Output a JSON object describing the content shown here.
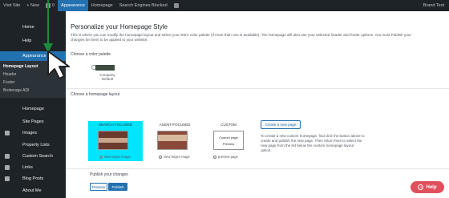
{
  "topbar": {
    "items": [
      {
        "label": "Visit Site"
      },
      {
        "label": "+ New"
      },
      {
        "label": "0"
      },
      {
        "label": "Appearance"
      },
      {
        "label": "Homepage"
      },
      {
        "label": "Search Engines Blocked"
      }
    ],
    "right_label": "Brand Test"
  },
  "sidebar": {
    "items": [
      {
        "label": "Home"
      },
      {
        "label": "Help"
      },
      {
        "label": "Appearance"
      },
      {
        "label": "Homepage"
      },
      {
        "label": "Site Pages"
      },
      {
        "label": "Images"
      },
      {
        "label": "Property Lists"
      },
      {
        "label": "Custom Search"
      },
      {
        "label": "Links"
      },
      {
        "label": "Blog Posts"
      },
      {
        "label": "About Me"
      }
    ],
    "subitems": [
      {
        "label": "Homepage Layout"
      },
      {
        "label": "Header"
      },
      {
        "label": "Footer"
      },
      {
        "label": "Brokerage ADI"
      }
    ]
  },
  "main": {
    "title": "Personalize your Homepage Style",
    "description": "This is where you can modify the homepage layout and select your site's color palette (if more than one is available). The homepage will also use your selected header and footer options. You must Publish your changes for them to be applied to your website.",
    "color_palette_label": "Choose a color palette",
    "palette": {
      "name_line1": "Company",
      "name_line2": "Default",
      "color": "#3c4a40"
    },
    "layout_label": "Choose a homepage layout",
    "layouts": [
      {
        "title": "SEARCH FOCUSED",
        "link": "view larger image"
      },
      {
        "title": "AGENT-FOCUSED",
        "link": "view larger image"
      },
      {
        "title": "CUSTOM",
        "thumb_line1": "Custom page",
        "thumb_line2": "Preview",
        "link": "preview page"
      }
    ],
    "create_button": "Create a new page",
    "create_text": "To create a new custom homepage, find click the button above to create and publish the new page. Then return here to select the new page from the list below the custom homepage layout option.",
    "publish_label": "Publish your changes",
    "preview_button": "Preview",
    "publish_button": "Publish"
  },
  "help_button": "Help",
  "colors": {
    "admin_bar": "#1d2327",
    "accent": "#2271b1",
    "selected_highlight": "#00e5ff",
    "arrow_green": "#1e8a3c",
    "help_red": "#e0505c"
  }
}
